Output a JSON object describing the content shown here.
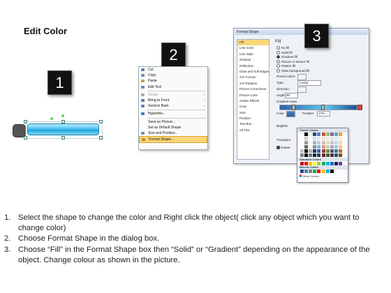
{
  "page": {
    "title": "Edit Color"
  },
  "steps": [
    "1",
    "2",
    "3"
  ],
  "context_menu": {
    "items": [
      {
        "label": "Cut",
        "state": "normal",
        "icon": "scissors-icon"
      },
      {
        "label": "Copy",
        "state": "normal",
        "icon": "copy-icon"
      },
      {
        "label": "Paste",
        "state": "normal",
        "icon": "paste-icon"
      },
      {
        "label": "Edit Text",
        "state": "normal",
        "icon": "edit-text-icon"
      },
      {
        "label": "Group",
        "state": "disabled",
        "icon": "group-icon",
        "submenu": true
      },
      {
        "label": "Bring to Front",
        "state": "normal",
        "icon": "bring-front-icon",
        "submenu": true
      },
      {
        "label": "Send to Back",
        "state": "normal",
        "icon": "send-back-icon",
        "submenu": true
      },
      {
        "label": "Hyperlink...",
        "state": "normal",
        "icon": "hyperlink-icon"
      },
      {
        "label": "Save as Picture...",
        "state": "normal",
        "icon": ""
      },
      {
        "label": "Set as Default Shape",
        "state": "normal",
        "icon": ""
      },
      {
        "label": "Size and Position...",
        "state": "normal",
        "icon": "size-position-icon"
      },
      {
        "label": "Format Shape...",
        "state": "highlighted",
        "icon": "format-shape-icon"
      }
    ]
  },
  "dialog": {
    "title": "Format Shape",
    "nav": [
      "Fill",
      "Line Color",
      "Line Style",
      "Shadow",
      "Reflection",
      "Glow and Soft Edges",
      "3-D Format",
      "3-D Rotation",
      "Picture Corrections",
      "Picture Color",
      "Artistic Effects",
      "Crop",
      "Size",
      "Position",
      "Text Box",
      "Alt Text"
    ],
    "active_nav": "Fill",
    "fill_heading": "Fill",
    "fill_options": [
      {
        "label": "No fill",
        "selected": false
      },
      {
        "label": "Solid fill",
        "selected": false
      },
      {
        "label": "Gradient fill",
        "selected": true
      },
      {
        "label": "Picture or texture fill",
        "selected": false
      },
      {
        "label": "Pattern fill",
        "selected": false
      },
      {
        "label": "Slide background fill",
        "selected": false
      }
    ],
    "preset_colors_label": "Preset colors:",
    "type_label": "Type:",
    "type_value": "Linear",
    "direction_label": "Direction:",
    "angle_label": "Angle:",
    "angle_value": "90°",
    "gradient_stops_label": "Gradient stops",
    "color_label": "Color",
    "position_label": "Position:",
    "position_value": "17%",
    "brightness_label": "Brightne",
    "transparency_label": "Transpare",
    "rotate_label": "Rotate"
  },
  "color_popup": {
    "theme_header": "Theme Colors",
    "standard_header": "Standard Colors",
    "recent_header": "Recent Colors",
    "more_label": "More Colors...",
    "theme_top": [
      "#ffffff",
      "#000000",
      "#eeece1",
      "#1f497d",
      "#4f81bd",
      "#c0504d",
      "#9bbb59",
      "#8064a2",
      "#4bacc6",
      "#f79646"
    ],
    "standard": [
      "#c00000",
      "#ff0000",
      "#ffc000",
      "#ffff00",
      "#92d050",
      "#00b050",
      "#00b0f0",
      "#0070c0",
      "#002060",
      "#7030a0"
    ],
    "recent": [
      "#1f497d",
      "#4f81bd",
      "#7f7f7f",
      "#00b050",
      "#ff0000",
      "#ffc000",
      "#00b0f0",
      "#000000"
    ]
  },
  "instructions": [
    {
      "num": "1.",
      "text": "Select the shape to change the color and Right click the object( click any object which you want to change color)"
    },
    {
      "num": "2.",
      "text": "Choose Format Shape in the dialog box."
    },
    {
      "num": "3.",
      "text": "Choose “Fill” in the Format Shape box then “Solid” or “Gradient” depending on the appearance of the object. Change colour as shown in the picture."
    }
  ]
}
